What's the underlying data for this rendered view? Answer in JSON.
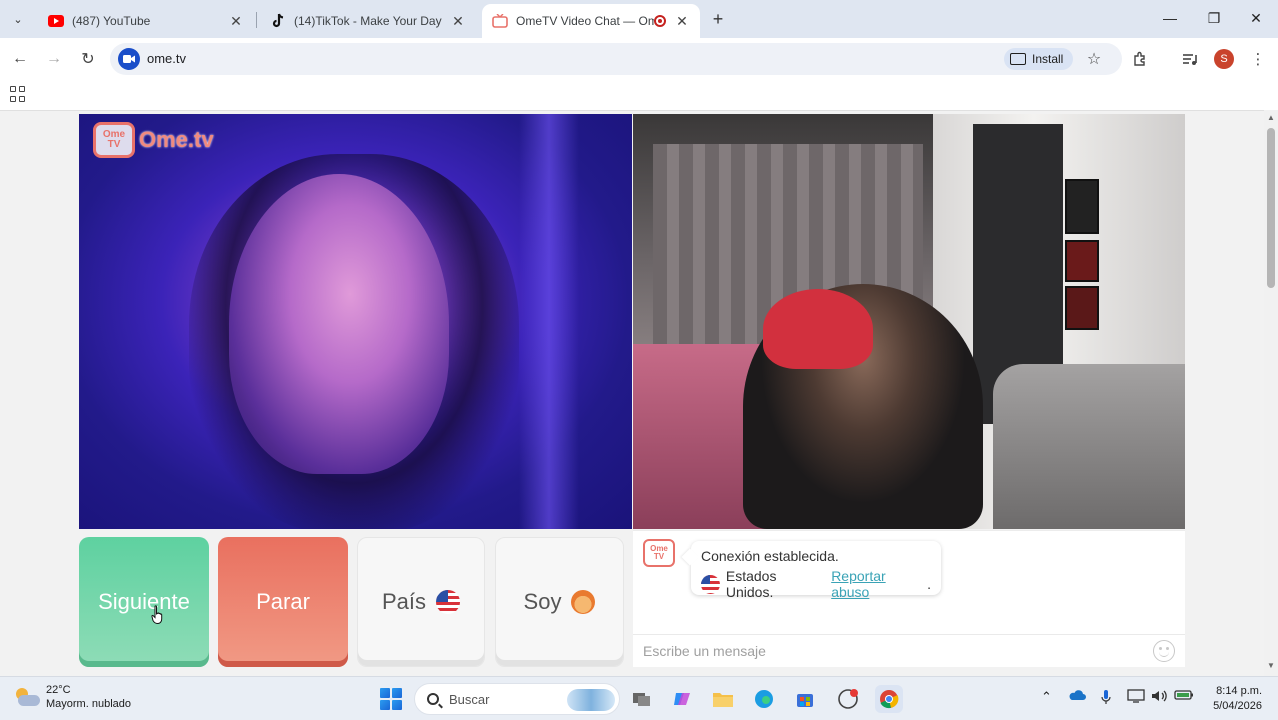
{
  "browser": {
    "tabs": [
      {
        "title": "(487) YouTube",
        "icon": "youtube-icon",
        "active": false
      },
      {
        "title": "(14)TikTok - Make Your Day",
        "icon": "tiktok-icon",
        "active": false
      },
      {
        "title": "OmeTV Video Chat — Ome",
        "icon": "ometv-icon",
        "active": true
      }
    ],
    "url": "ome.tv",
    "install_label": "Install",
    "profile_initial": "S"
  },
  "page": {
    "logo_text": "Ome.tv",
    "logo_badge_top": "Ome",
    "logo_badge_bottom": "TV",
    "buttons": {
      "next": "Siguiente",
      "stop": "Parar",
      "country": "País",
      "gender": "Soy"
    },
    "chat": {
      "status": "Conexión establecida.",
      "country": "Estados Unidos.",
      "report_link": "Reportar abuso",
      "report_suffix": ".",
      "input_placeholder": "Escribe un mensaje"
    }
  },
  "taskbar": {
    "weather_temp": "22°C",
    "weather_desc": "Mayorm. nublado",
    "search_placeholder": "Buscar",
    "time": "8:14 p.m.",
    "date": "5/04/2026"
  },
  "colors": {
    "next_button": "#5ed1a0",
    "stop_button": "#e9705f",
    "brand": "#e8726a",
    "link": "#3aa3b6"
  }
}
